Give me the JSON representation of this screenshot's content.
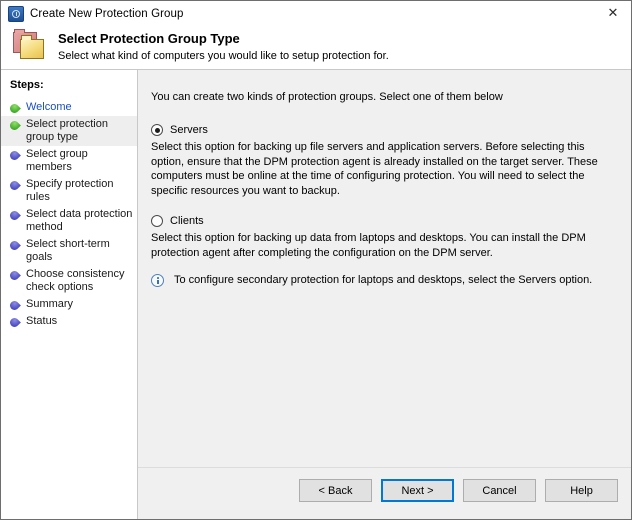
{
  "window": {
    "title": "Create New Protection Group",
    "app_icon": "dpm-icon",
    "close_label": "✕"
  },
  "header": {
    "icon": "folders-icon",
    "title": "Select Protection Group Type",
    "subtitle": "Select what kind of computers you would like to setup protection for."
  },
  "sidebar": {
    "label": "Steps:",
    "items": [
      {
        "label": "Welcome",
        "state": "done",
        "link": true,
        "current": false
      },
      {
        "label": "Select protection group type",
        "state": "done",
        "link": false,
        "current": true
      },
      {
        "label": "Select group members",
        "state": "todo",
        "link": false,
        "current": false
      },
      {
        "label": "Specify protection rules",
        "state": "todo",
        "link": false,
        "current": false
      },
      {
        "label": "Select data protection method",
        "state": "todo",
        "link": false,
        "current": false
      },
      {
        "label": "Select short-term goals",
        "state": "todo",
        "link": false,
        "current": false
      },
      {
        "label": "Choose consistency check options",
        "state": "todo",
        "link": false,
        "current": false
      },
      {
        "label": "Summary",
        "state": "todo",
        "link": false,
        "current": false
      },
      {
        "label": "Status",
        "state": "todo",
        "link": false,
        "current": false
      }
    ]
  },
  "main": {
    "intro": "You can create two kinds of protection groups. Select one of them below",
    "options": [
      {
        "id": "servers",
        "label": "Servers",
        "selected": true,
        "description": "Select this option for backing up file servers and application servers. Before selecting this option, ensure that the DPM protection agent is already installed on the target server. These computers must be online at the time of configuring protection. You will need to select the specific resources you want to backup."
      },
      {
        "id": "clients",
        "label": "Clients",
        "selected": false,
        "description": "Select this option for backing up data from laptops and desktops. You can install the DPM protection agent after completing the configuration on the DPM server."
      }
    ],
    "note": {
      "icon": "info-icon",
      "text": "To configure secondary protection for laptops and desktops, select the Servers option."
    }
  },
  "footer": {
    "buttons": [
      {
        "label": "< Back",
        "default": false
      },
      {
        "label": "Next >",
        "default": true
      },
      {
        "label": "Cancel",
        "default": false
      },
      {
        "label": "Help",
        "default": false
      }
    ]
  },
  "colors": {
    "accent": "#0078d7",
    "link": "#1b4fbf",
    "done_bullet": "#3faa28",
    "todo_bullet": "#4a4ac0",
    "panel_bg": "#f0f0f0",
    "sidebar_bg": "#ffffff"
  }
}
